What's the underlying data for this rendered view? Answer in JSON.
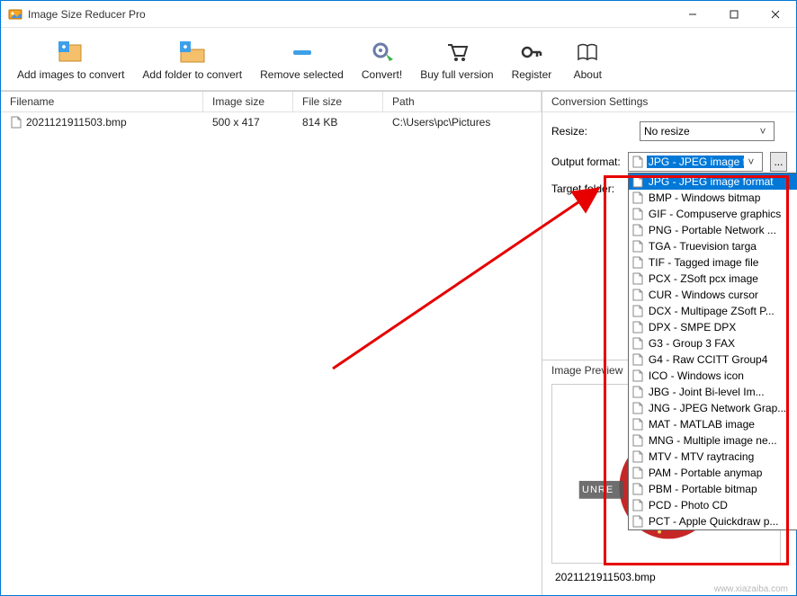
{
  "window": {
    "title": "Image Size Reducer Pro"
  },
  "toolbar": [
    {
      "id": "add-images",
      "label": "Add images to convert"
    },
    {
      "id": "add-folder",
      "label": "Add folder to convert"
    },
    {
      "id": "remove-selected",
      "label": "Remove selected"
    },
    {
      "id": "convert",
      "label": "Convert!"
    },
    {
      "id": "buy",
      "label": "Buy full version"
    },
    {
      "id": "register",
      "label": "Register"
    },
    {
      "id": "about",
      "label": "About"
    }
  ],
  "columns": {
    "filename": "Filename",
    "image_size": "Image size",
    "file_size": "File size",
    "path": "Path"
  },
  "rows": [
    {
      "filename": "2021121911503.bmp",
      "image_size": "500 x 417",
      "file_size": "814 KB",
      "path": "C:\\Users\\pc\\Pictures"
    }
  ],
  "right": {
    "settings_title": "Conversion Settings",
    "resize_label": "Resize:",
    "resize_value": "No resize",
    "output_label": "Output format:",
    "output_value": "JPG - JPEG image format",
    "target_label": "Target folder:",
    "target_value": "",
    "browse": "...",
    "formats": [
      "JPG - JPEG image format",
      "BMP - Windows bitmap",
      "GIF - Compuserve graphics",
      "PNG - Portable Network ...",
      "TGA - Truevision targa",
      "TIF - Tagged image file",
      "PCX - ZSoft pcx image",
      "CUR - Windows cursor",
      "DCX - Multipage ZSoft P...",
      "DPX - SMPE DPX",
      "G3 - Group 3 FAX",
      "G4 - Raw CCITT Group4",
      "ICO - Windows icon",
      "JBG - Joint Bi-level Im...",
      "JNG - JPEG Network Grap...",
      "MAT - MATLAB image",
      "MNG - Multiple image ne...",
      "MTV - MTV raytracing",
      "PAM - Portable anymap",
      "PBM - Portable bitmap",
      "PCD - Photo CD",
      "PCT - Apple Quickdraw p..."
    ],
    "preview_title": "Image Preview",
    "preview_label": "2021121911503.bmp",
    "preview_banner": "UNRE"
  },
  "watermark": "www.xiazaiba.com"
}
